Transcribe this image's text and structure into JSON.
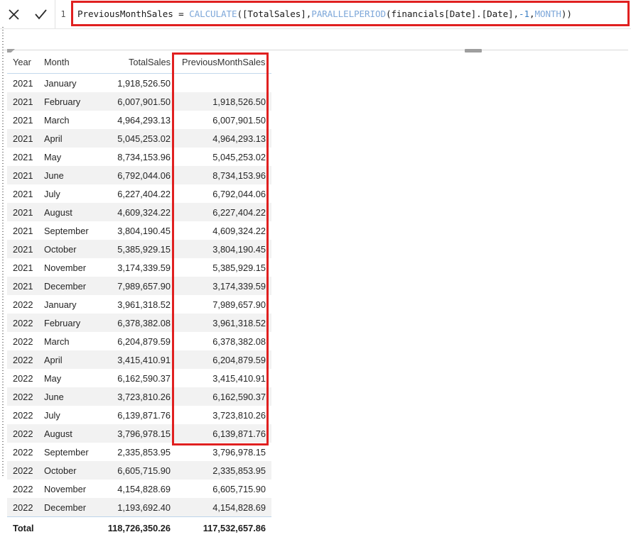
{
  "formula_bar": {
    "cancel_icon": "close-x-icon",
    "commit_icon": "checkmark-icon",
    "line_number": "1",
    "formula_full": "PreviousMonthSales = CALCULATE([TotalSales],PARALLELPERIOD(financials[Date].[Date],-1,MONTH))",
    "tokens": [
      {
        "text": "PreviousMonthSales = ",
        "kind": "plain"
      },
      {
        "text": "CALCULATE",
        "kind": "func"
      },
      {
        "text": "([TotalSales],",
        "kind": "plain"
      },
      {
        "text": "PARALLELPERIOD",
        "kind": "func"
      },
      {
        "text": "(financials[Date].[Date],",
        "kind": "plain"
      },
      {
        "text": "-1",
        "kind": "num"
      },
      {
        "text": ",",
        "kind": "plain"
      },
      {
        "text": "MONTH",
        "kind": "func"
      },
      {
        "text": "))",
        "kind": "plain"
      }
    ],
    "border_color": "#e02020"
  },
  "table": {
    "columns": [
      "Year",
      "Month",
      "TotalSales",
      "PreviousMonthSales"
    ],
    "highlight_column": "PreviousMonthSales",
    "highlight_color": "#e02020",
    "rows": [
      {
        "year": "2021",
        "month": "January",
        "total": "1,918,526.50",
        "prev": ""
      },
      {
        "year": "2021",
        "month": "February",
        "total": "6,007,901.50",
        "prev": "1,918,526.50"
      },
      {
        "year": "2021",
        "month": "March",
        "total": "4,964,293.13",
        "prev": "6,007,901.50"
      },
      {
        "year": "2021",
        "month": "April",
        "total": "5,045,253.02",
        "prev": "4,964,293.13"
      },
      {
        "year": "2021",
        "month": "May",
        "total": "8,734,153.96",
        "prev": "5,045,253.02"
      },
      {
        "year": "2021",
        "month": "June",
        "total": "6,792,044.06",
        "prev": "8,734,153.96"
      },
      {
        "year": "2021",
        "month": "July",
        "total": "6,227,404.22",
        "prev": "6,792,044.06"
      },
      {
        "year": "2021",
        "month": "August",
        "total": "4,609,324.22",
        "prev": "6,227,404.22"
      },
      {
        "year": "2021",
        "month": "September",
        "total": "3,804,190.45",
        "prev": "4,609,324.22"
      },
      {
        "year": "2021",
        "month": "October",
        "total": "5,385,929.15",
        "prev": "3,804,190.45"
      },
      {
        "year": "2021",
        "month": "November",
        "total": "3,174,339.59",
        "prev": "5,385,929.15"
      },
      {
        "year": "2021",
        "month": "December",
        "total": "7,989,657.90",
        "prev": "3,174,339.59"
      },
      {
        "year": "2022",
        "month": "January",
        "total": "3,961,318.52",
        "prev": "7,989,657.90"
      },
      {
        "year": "2022",
        "month": "February",
        "total": "6,378,382.08",
        "prev": "3,961,318.52"
      },
      {
        "year": "2022",
        "month": "March",
        "total": "6,204,879.59",
        "prev": "6,378,382.08"
      },
      {
        "year": "2022",
        "month": "April",
        "total": "3,415,410.91",
        "prev": "6,204,879.59"
      },
      {
        "year": "2022",
        "month": "May",
        "total": "6,162,590.37",
        "prev": "3,415,410.91"
      },
      {
        "year": "2022",
        "month": "June",
        "total": "3,723,810.26",
        "prev": "6,162,590.37"
      },
      {
        "year": "2022",
        "month": "July",
        "total": "6,139,871.76",
        "prev": "3,723,810.26"
      },
      {
        "year": "2022",
        "month": "August",
        "total": "3,796,978.15",
        "prev": "6,139,871.76"
      },
      {
        "year": "2022",
        "month": "September",
        "total": "2,335,853.95",
        "prev": "3,796,978.15"
      },
      {
        "year": "2022",
        "month": "October",
        "total": "6,605,715.90",
        "prev": "2,335,853.95"
      },
      {
        "year": "2022",
        "month": "November",
        "total": "4,154,828.69",
        "prev": "6,605,715.90"
      },
      {
        "year": "2022",
        "month": "December",
        "total": "1,193,692.40",
        "prev": "4,154,828.69"
      }
    ],
    "total_row": {
      "label": "Total",
      "month": "",
      "total": "118,726,350.26",
      "prev": "117,532,657.86"
    }
  }
}
